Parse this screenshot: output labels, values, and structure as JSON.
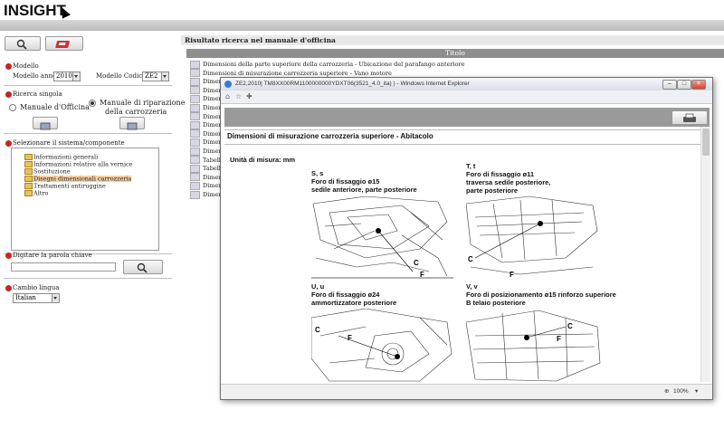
{
  "header": {
    "logo": "INSIGHT"
  },
  "left": {
    "model_section": {
      "title": "Modello",
      "year_label": "Modello anno",
      "year_value": "2010",
      "code_label": "Modello Codice",
      "code_value": "ZE2"
    },
    "search_section": {
      "title": "Ricerca singola",
      "option1": "Manuale d'Officina",
      "option2_line1": "Manuale di riparazione",
      "option2_line2": "della carrozzeria"
    },
    "system_section": {
      "title": "Selezionare il sistema/componente",
      "items": [
        "Informazioni generali",
        "Informazioni relative alla vernice",
        "Sostituzione",
        "Disegni dimensionali carrozzeria",
        "Trattamenti antiruggine",
        "Altro"
      ]
    },
    "keyword_section": {
      "title": "Digitare la parola chiave",
      "value": ""
    },
    "language_section": {
      "title": "Cambio lingua",
      "value": "Italian"
    }
  },
  "results": {
    "header": "Risultato ricerca nel manuale d'officina",
    "column": "Titolo",
    "rows": [
      "Dimensioni della parte superiore della carrozzeria - Ubicazione del parafango anteriore",
      "Dimensioni di misurazione carrozzeria superiore - Vano motore",
      "Dimen",
      "Dimen",
      "Dimen",
      "Dimen",
      "Dimen",
      "Dimen",
      "Dimen",
      "Dimen",
      "Dimen",
      "Tabell",
      "Tabell",
      "Dimen",
      "Dimen",
      "Dimen"
    ]
  },
  "popup": {
    "window_title": "ZE2,2010| TM8XX00RM1100000000YDXT06(3521_4.0_ita) ) - Windows Internet Explorer",
    "page_title": "Dimensioni di misurazione carrozzeria superiore - Abitacolo",
    "unit_label": "Unità di misura: mm",
    "figures": [
      {
        "line1": "S, s",
        "line2": "Foro di fissaggio ø15",
        "line3": "sedile anteriore, parte posteriore"
      },
      {
        "line1": "T, t",
        "line2": "Foro di fissaggio ø11",
        "line3": "traversa sedile posteriore,",
        "line4": "parte posteriore"
      },
      {
        "line1": "U, u",
        "line2": "Foro di fissaggio ø24",
        "line3": "ammortizzatore posteriore"
      },
      {
        "line1": "V, v",
        "line2": "Foro di posizionamento ø15 rinforzo superiore",
        "line3": "B telaio posteriore"
      }
    ],
    "zoom": "100%"
  }
}
